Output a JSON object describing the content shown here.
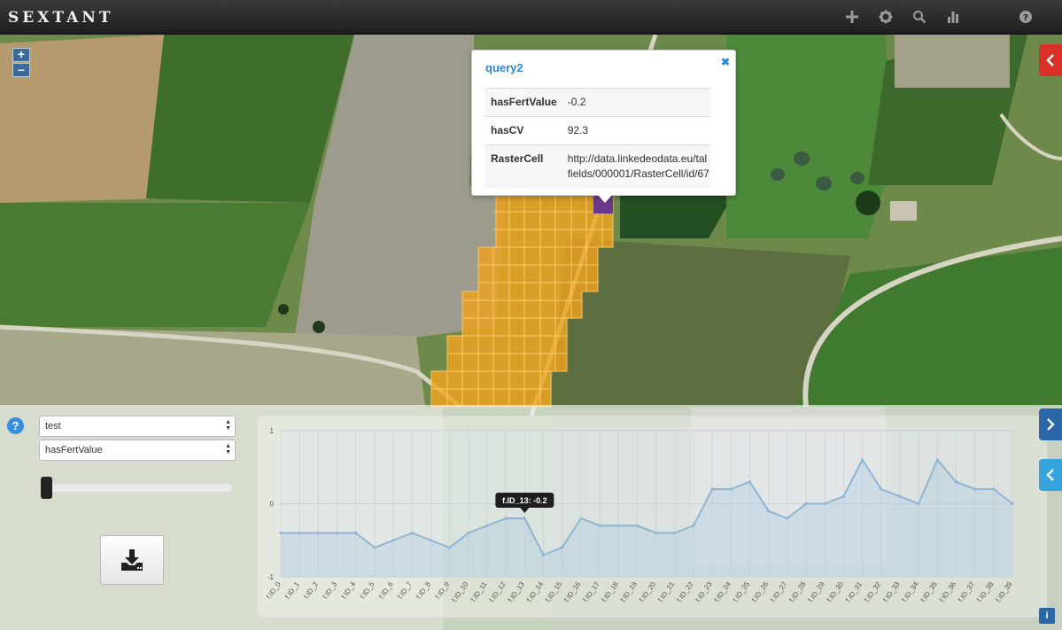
{
  "app": {
    "title": "SEXTANT"
  },
  "toolbar": {
    "icons": [
      "plus-icon",
      "gear-icon",
      "search-icon",
      "bar-chart-icon",
      "help-icon"
    ]
  },
  "map": {
    "zoom_in": "+",
    "zoom_out": "–"
  },
  "popup": {
    "title": "query2",
    "close": "✖",
    "rows": [
      {
        "key": "hasFertValue",
        "value": "-0.2"
      },
      {
        "key": "hasCV",
        "value": "92.3"
      },
      {
        "key": "RasterCell",
        "value": "http://data.linkedeodata.eu/tal",
        "value2": "fields/000001/RasterCell/id/67"
      }
    ]
  },
  "panel": {
    "help": "?",
    "dataset_select": "test",
    "property_select": "hasFertValue",
    "info": "i"
  },
  "colors": {
    "accent": "#3a8ede",
    "red_tab": "#d9302a",
    "blue_tab": "#2a67a8",
    "light_blue_tab": "#36a4dc",
    "grid_cell": "#f3a21b",
    "selected_cell": "#6a3a8a",
    "series_line": "#8fb5d2"
  },
  "chart_data": {
    "type": "area",
    "categories": [
      "f.ID_0",
      "f.ID_1",
      "f.ID_2",
      "f.ID_3",
      "f.ID_4",
      "f.ID_5",
      "f.ID_6",
      "f.ID_7",
      "f.ID_8",
      "f.ID_9",
      "f.ID_10",
      "f.ID_11",
      "f.ID_12",
      "f.ID_13",
      "f.ID_14",
      "f.ID_15",
      "f.ID_16",
      "f.ID_17",
      "f.ID_18",
      "f.ID_19",
      "f.ID_20",
      "f.ID_21",
      "f.ID_22",
      "f.ID_23",
      "f.ID_24",
      "f.ID_25",
      "f.ID_26",
      "f.ID_27",
      "f.ID_28",
      "f.ID_29",
      "f.ID_30",
      "f.ID_31",
      "f.ID_32",
      "f.ID_33",
      "f.ID_34",
      "f.ID_35",
      "f.ID_36",
      "f.ID_37",
      "f.ID_38",
      "f.ID_39"
    ],
    "values": [
      -0.4,
      -0.4,
      -0.4,
      -0.4,
      -0.4,
      -0.6,
      -0.5,
      -0.4,
      -0.5,
      -0.6,
      -0.4,
      -0.3,
      -0.2,
      -0.2,
      -0.7,
      -0.6,
      -0.2,
      -0.3,
      -0.3,
      -0.3,
      -0.4,
      -0.4,
      -0.3,
      0.2,
      0.2,
      0.3,
      -0.1,
      -0.2,
      0.0,
      0.0,
      0.1,
      0.6,
      0.2,
      0.1,
      0.0,
      0.6,
      0.3,
      0.2,
      0.2,
      0.0
    ],
    "ylim": [
      -1,
      1
    ],
    "yticks": [
      "1",
      "0",
      "-1"
    ],
    "grid": true,
    "tooltip": "f.ID_13: -0.2",
    "tooltip_index": 13
  }
}
